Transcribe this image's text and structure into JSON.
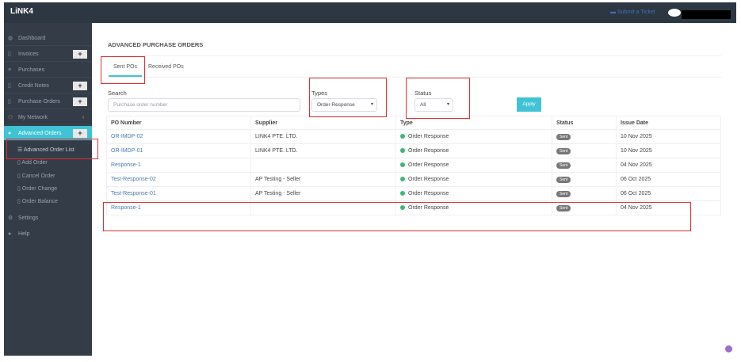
{
  "header": {
    "logo": "LiNK4",
    "ticket": "Submit a Ticket"
  },
  "sidebar": {
    "items": [
      {
        "label": "Dashboard",
        "plus": false
      },
      {
        "label": "Invoices",
        "plus": true
      },
      {
        "label": "Purchases",
        "plus": false
      },
      {
        "label": "Credit Notes",
        "plus": true
      },
      {
        "label": "Purchase Orders",
        "plus": true
      },
      {
        "label": "My Network",
        "plus": false,
        "chevron": "‹"
      },
      {
        "label": "Advanced Orders",
        "plus": true
      }
    ],
    "plus_label": "+",
    "sub": [
      "Advanced Order List",
      "Add Order",
      "Cancel Order",
      "Order Change",
      "Order Balance"
    ],
    "bottom": [
      "Settings",
      "Help"
    ]
  },
  "main": {
    "title": "ADVANCED PURCHASE ORDERS",
    "tabs": [
      "Sent POs",
      "Received POs"
    ],
    "search": {
      "label": "Search",
      "placeholder": "Purchase order number"
    },
    "types": {
      "label": "Types",
      "value": "Order Response"
    },
    "status": {
      "label": "Status",
      "value": "All"
    },
    "apply": "Apply",
    "columns": [
      "PO Number",
      "Supplier",
      "Type",
      "Status",
      "Issue Date"
    ],
    "rows": [
      [
        "OR-IMDP-02",
        "LINK4 PTE. LTD.",
        "Order Response",
        "Sent",
        "10 Nov 2025"
      ],
      [
        "OR-IMDP-01",
        "LINK4 PTE. LTD.",
        "Order Response",
        "Sent",
        "10 Nov 2025"
      ],
      [
        "Response-1",
        "",
        "Order Response",
        "Sent",
        "04 Nov 2025"
      ],
      [
        "Test-Response-02",
        "AP Testing - Seller",
        "Order Response",
        "Sent",
        "06 Oct 2025"
      ],
      [
        "Test-Response-01",
        "AP Testing - Seller",
        "Order Response",
        "Sent",
        "06 Oct 2025"
      ],
      [
        "Response-1",
        "",
        "Order Response",
        "Sent",
        "04 Nov 2025"
      ]
    ]
  }
}
